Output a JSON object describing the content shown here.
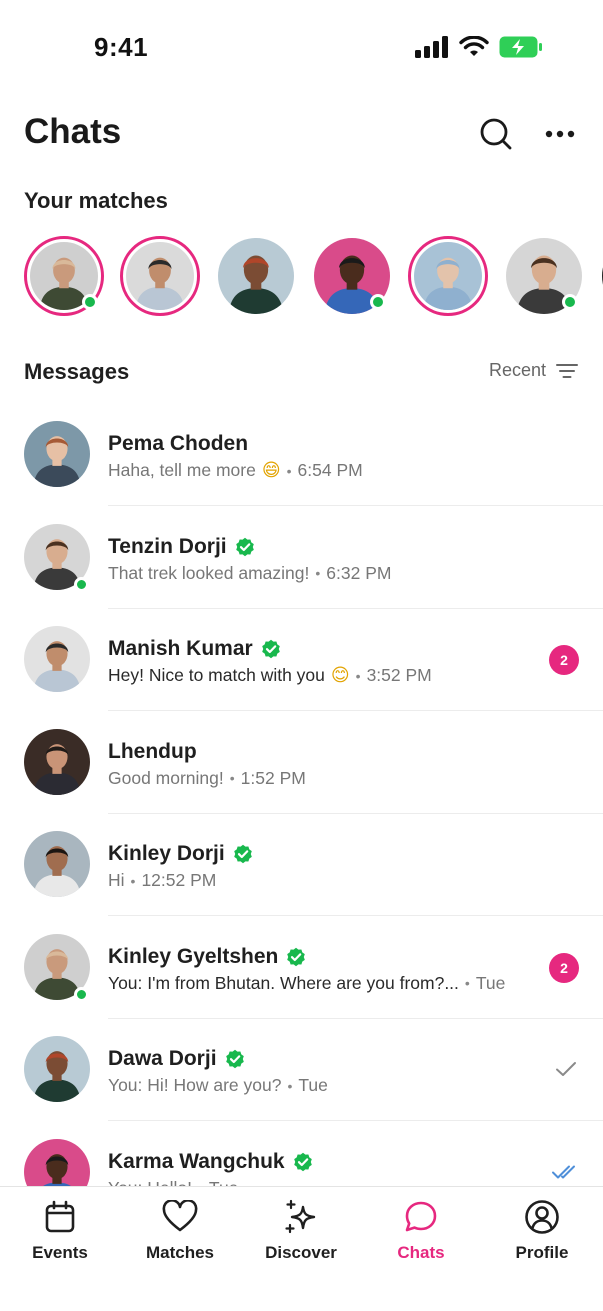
{
  "status_bar": {
    "time": "9:41"
  },
  "header": {
    "title": "Chats"
  },
  "matches": {
    "title": "Your matches",
    "items": [
      {
        "ringed": true,
        "online": true,
        "bg": "#cfcfcf",
        "skin": "#c99a7c",
        "hair": "#d9b99a",
        "shirt": "#3e4a34"
      },
      {
        "ringed": true,
        "online": false,
        "bg": "#dadada",
        "skin": "#c08d6c",
        "hair": "#2a2a2a",
        "shirt": "#b9c6d4"
      },
      {
        "ringed": false,
        "online": false,
        "bg": "#b8cad4",
        "skin": "#7b4c34",
        "hair": "#b0462a",
        "shirt": "#1f3b32"
      },
      {
        "ringed": false,
        "online": true,
        "bg": "#d94b8a",
        "skin": "#4a2c1d",
        "hair": "#1a1a1a",
        "shirt": "#3567b8"
      },
      {
        "ringed": true,
        "online": false,
        "bg": "#a8c2d6",
        "skin": "#e3c3ab",
        "hair": "#8fb0cf",
        "shirt": "#8fb0cf"
      },
      {
        "ringed": false,
        "online": true,
        "bg": "#d6d6d6",
        "skin": "#d8ad8f",
        "hair": "#4a3120",
        "shirt": "#3a3a3a"
      }
    ]
  },
  "messages": {
    "title": "Messages",
    "sort_label": "Recent",
    "items": [
      {
        "name": "Pema Choden",
        "verified": false,
        "preview": "Haha, tell me more",
        "emoji": "😄",
        "time": "6:54 PM",
        "online": false,
        "badge": null,
        "status": null,
        "dark": false,
        "bg": "#7d98a8",
        "skin": "#e6c0a5",
        "hair": "#a65a36",
        "shirt": "#3b4a5a"
      },
      {
        "name": "Tenzin Dorji",
        "verified": true,
        "preview": "That trek looked amazing!",
        "emoji": null,
        "time": "6:32 PM",
        "online": true,
        "badge": null,
        "status": null,
        "dark": false,
        "bg": "#d6d6d6",
        "skin": "#d8ad8f",
        "hair": "#4a3120",
        "shirt": "#3a3a3a"
      },
      {
        "name": "Manish Kumar",
        "verified": true,
        "preview": "Hey! Nice to match with you",
        "emoji": "😊",
        "time": "3:52 PM",
        "online": false,
        "badge": "2",
        "status": null,
        "dark": true,
        "bg": "#e2e2e2",
        "skin": "#c08d6c",
        "hair": "#2a2a2a",
        "shirt": "#b9c6d4"
      },
      {
        "name": "Lhendup",
        "verified": false,
        "preview": "Good morning!",
        "emoji": null,
        "time": "1:52 PM",
        "online": false,
        "badge": null,
        "status": null,
        "dark": false,
        "bg": "#3a2c26",
        "skin": "#c99477",
        "hair": "#1f1a17",
        "shirt": "#2b2b33"
      },
      {
        "name": "Kinley Dorji",
        "verified": true,
        "preview": "Hi",
        "emoji": null,
        "time": "12:52 PM",
        "online": false,
        "badge": null,
        "status": null,
        "dark": false,
        "bg": "#a9b6bf",
        "skin": "#a06d4f",
        "hair": "#1c1612",
        "shirt": "#e8e8e8"
      },
      {
        "name": "Kinley Gyeltshen",
        "verified": true,
        "preview": "You: I'm from Bhutan. Where are you from?...",
        "emoji": null,
        "time": "Tue",
        "online": true,
        "badge": "2",
        "status": null,
        "dark": true,
        "bg": "#cfcfcf",
        "skin": "#c99a7c",
        "hair": "#d9b99a",
        "shirt": "#3e4a34"
      },
      {
        "name": "Dawa Dorji",
        "verified": true,
        "preview": "You: Hi! How are you?",
        "emoji": null,
        "time": "Tue",
        "online": false,
        "badge": null,
        "status": "sent",
        "dark": false,
        "bg": "#b8cad4",
        "skin": "#7b4c34",
        "hair": "#b0462a",
        "shirt": "#1f3b32"
      },
      {
        "name": "Karma Wangchuk",
        "verified": true,
        "preview": "You: Hello!",
        "emoji": null,
        "time": "Tue",
        "online": false,
        "badge": null,
        "status": "read",
        "dark": false,
        "bg": "#d94b8a",
        "skin": "#4a2c1d",
        "hair": "#1a1a1a",
        "shirt": "#3567b8"
      }
    ]
  },
  "nav": {
    "items": [
      {
        "key": "events",
        "label": "Events",
        "icon": "calendar-icon",
        "active": false
      },
      {
        "key": "matches",
        "label": "Matches",
        "icon": "heart-icon",
        "active": false
      },
      {
        "key": "discover",
        "label": "Discover",
        "icon": "sparkles-icon",
        "active": false
      },
      {
        "key": "chats",
        "label": "Chats",
        "icon": "chat-bubble-icon",
        "active": true
      },
      {
        "key": "profile",
        "label": "Profile",
        "icon": "user-circle-icon",
        "active": false
      }
    ]
  },
  "colors": {
    "accent": "#e6287f",
    "online": "#18b84d",
    "verified": "#18b84d",
    "read": "#4f8fd9"
  }
}
